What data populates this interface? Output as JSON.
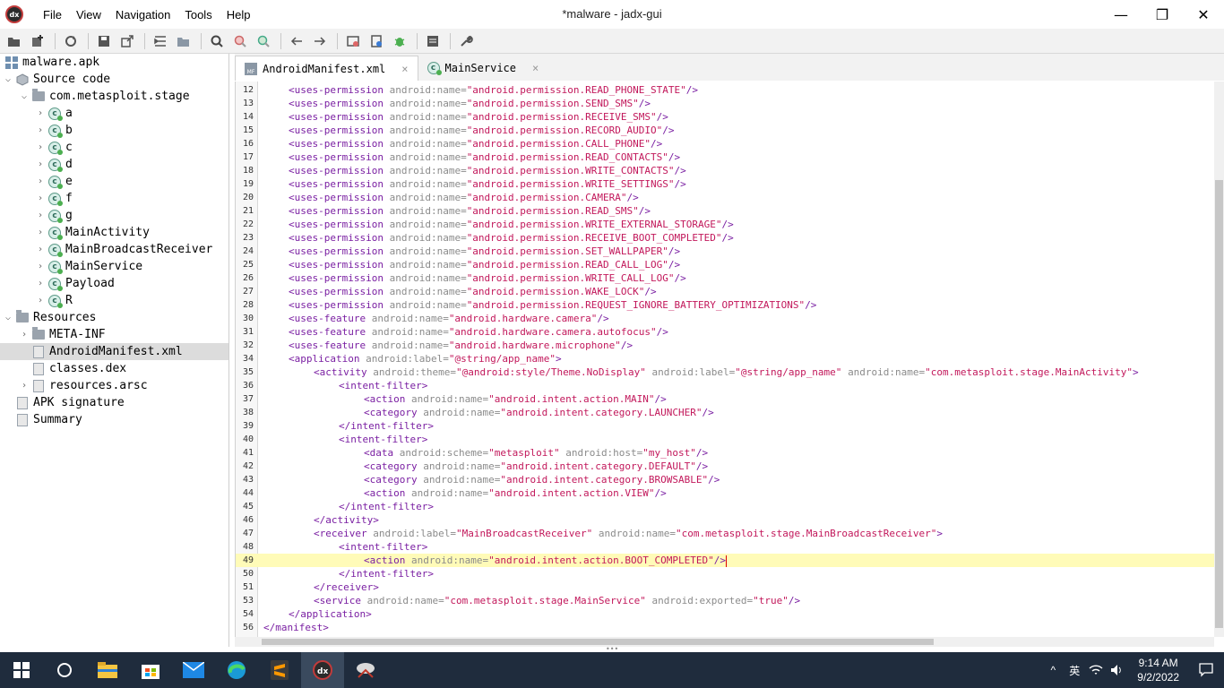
{
  "window": {
    "title": "*malware - jadx-gui",
    "app_icon_text": "dx",
    "minimize": "—",
    "maximize": "❐",
    "close": "✕"
  },
  "menu": [
    "File",
    "View",
    "Navigation",
    "Tools",
    "Help"
  ],
  "toolbar": {
    "icons": [
      "open-icon",
      "add-files-icon",
      "sync-icon",
      "save-icon",
      "export-icon",
      "flatten-icon",
      "packages-icon",
      "search-icon",
      "find-usage-icon",
      "goto-icon",
      "back-icon",
      "forward-icon",
      "decompile-icon",
      "bookmark-icon",
      "debug-icon",
      "log-icon",
      "settings-icon"
    ]
  },
  "tree": {
    "items": [
      {
        "label": "malware.apk",
        "level": 0,
        "arrow": "",
        "icon": "apk"
      },
      {
        "label": "Source code",
        "level": 0,
        "arrow": "v",
        "icon": "package"
      },
      {
        "label": "com.metasploit.stage",
        "level": 1,
        "arrow": "v",
        "icon": "folder"
      },
      {
        "label": "a",
        "level": 2,
        "arrow": ">",
        "icon": "class"
      },
      {
        "label": "b",
        "level": 2,
        "arrow": ">",
        "icon": "class"
      },
      {
        "label": "c",
        "level": 2,
        "arrow": ">",
        "icon": "class"
      },
      {
        "label": "d",
        "level": 2,
        "arrow": ">",
        "icon": "class"
      },
      {
        "label": "e",
        "level": 2,
        "arrow": ">",
        "icon": "class"
      },
      {
        "label": "f",
        "level": 2,
        "arrow": ">",
        "icon": "class"
      },
      {
        "label": "g",
        "level": 2,
        "arrow": ">",
        "icon": "class"
      },
      {
        "label": "MainActivity",
        "level": 2,
        "arrow": ">",
        "icon": "class"
      },
      {
        "label": "MainBroadcastReceiver",
        "level": 2,
        "arrow": ">",
        "icon": "class"
      },
      {
        "label": "MainService",
        "level": 2,
        "arrow": ">",
        "icon": "class"
      },
      {
        "label": "Payload",
        "level": 2,
        "arrow": ">",
        "icon": "class"
      },
      {
        "label": "R",
        "level": 2,
        "arrow": ">",
        "icon": "class"
      },
      {
        "label": "Resources",
        "level": 0,
        "arrow": "v",
        "icon": "folder"
      },
      {
        "label": "META-INF",
        "level": 1,
        "arrow": ">",
        "icon": "folder"
      },
      {
        "label": "AndroidManifest.xml",
        "level": 1,
        "arrow": "",
        "icon": "file",
        "selected": true
      },
      {
        "label": "classes.dex",
        "level": 1,
        "arrow": "",
        "icon": "file"
      },
      {
        "label": "resources.arsc",
        "level": 1,
        "arrow": ">",
        "icon": "file"
      },
      {
        "label": "APK signature",
        "level": 0,
        "arrow": "",
        "icon": "file"
      },
      {
        "label": "Summary",
        "level": 0,
        "arrow": "",
        "icon": "file"
      }
    ]
  },
  "tabs": [
    {
      "label": "AndroidManifest.xml",
      "icon_text": "MF",
      "active": true,
      "close": "×"
    },
    {
      "label": "MainService",
      "icon_text": "c",
      "active": false,
      "close": "×"
    }
  ],
  "editor": {
    "current_line": "49",
    "lines": [
      {
        "n": "12",
        "indent": 4,
        "tag": "<uses-permission",
        "attrs": [
          [
            "android:name=",
            "\"android.permission.READ_PHONE_STATE\""
          ]
        ],
        "end": "/>"
      },
      {
        "n": "13",
        "indent": 4,
        "tag": "<uses-permission",
        "attrs": [
          [
            "android:name=",
            "\"android.permission.SEND_SMS\""
          ]
        ],
        "end": "/>"
      },
      {
        "n": "14",
        "indent": 4,
        "tag": "<uses-permission",
        "attrs": [
          [
            "android:name=",
            "\"android.permission.RECEIVE_SMS\""
          ]
        ],
        "end": "/>"
      },
      {
        "n": "15",
        "indent": 4,
        "tag": "<uses-permission",
        "attrs": [
          [
            "android:name=",
            "\"android.permission.RECORD_AUDIO\""
          ]
        ],
        "end": "/>"
      },
      {
        "n": "16",
        "indent": 4,
        "tag": "<uses-permission",
        "attrs": [
          [
            "android:name=",
            "\"android.permission.CALL_PHONE\""
          ]
        ],
        "end": "/>"
      },
      {
        "n": "17",
        "indent": 4,
        "tag": "<uses-permission",
        "attrs": [
          [
            "android:name=",
            "\"android.permission.READ_CONTACTS\""
          ]
        ],
        "end": "/>"
      },
      {
        "n": "18",
        "indent": 4,
        "tag": "<uses-permission",
        "attrs": [
          [
            "android:name=",
            "\"android.permission.WRITE_CONTACTS\""
          ]
        ],
        "end": "/>"
      },
      {
        "n": "19",
        "indent": 4,
        "tag": "<uses-permission",
        "attrs": [
          [
            "android:name=",
            "\"android.permission.WRITE_SETTINGS\""
          ]
        ],
        "end": "/>"
      },
      {
        "n": "20",
        "indent": 4,
        "tag": "<uses-permission",
        "attrs": [
          [
            "android:name=",
            "\"android.permission.CAMERA\""
          ]
        ],
        "end": "/>"
      },
      {
        "n": "21",
        "indent": 4,
        "tag": "<uses-permission",
        "attrs": [
          [
            "android:name=",
            "\"android.permission.READ_SMS\""
          ]
        ],
        "end": "/>"
      },
      {
        "n": "22",
        "indent": 4,
        "tag": "<uses-permission",
        "attrs": [
          [
            "android:name=",
            "\"android.permission.WRITE_EXTERNAL_STORAGE\""
          ]
        ],
        "end": "/>"
      },
      {
        "n": "23",
        "indent": 4,
        "tag": "<uses-permission",
        "attrs": [
          [
            "android:name=",
            "\"android.permission.RECEIVE_BOOT_COMPLETED\""
          ]
        ],
        "end": "/>"
      },
      {
        "n": "24",
        "indent": 4,
        "tag": "<uses-permission",
        "attrs": [
          [
            "android:name=",
            "\"android.permission.SET_WALLPAPER\""
          ]
        ],
        "end": "/>"
      },
      {
        "n": "25",
        "indent": 4,
        "tag": "<uses-permission",
        "attrs": [
          [
            "android:name=",
            "\"android.permission.READ_CALL_LOG\""
          ]
        ],
        "end": "/>"
      },
      {
        "n": "26",
        "indent": 4,
        "tag": "<uses-permission",
        "attrs": [
          [
            "android:name=",
            "\"android.permission.WRITE_CALL_LOG\""
          ]
        ],
        "end": "/>"
      },
      {
        "n": "27",
        "indent": 4,
        "tag": "<uses-permission",
        "attrs": [
          [
            "android:name=",
            "\"android.permission.WAKE_LOCK\""
          ]
        ],
        "end": "/>"
      },
      {
        "n": "28",
        "indent": 4,
        "tag": "<uses-permission",
        "attrs": [
          [
            "android:name=",
            "\"android.permission.REQUEST_IGNORE_BATTERY_OPTIMIZATIONS\""
          ]
        ],
        "end": "/>"
      },
      {
        "n": "30",
        "indent": 4,
        "tag": "<uses-feature",
        "attrs": [
          [
            "android:name=",
            "\"android.hardware.camera\""
          ]
        ],
        "end": "/>"
      },
      {
        "n": "31",
        "indent": 4,
        "tag": "<uses-feature",
        "attrs": [
          [
            "android:name=",
            "\"android.hardware.camera.autofocus\""
          ]
        ],
        "end": "/>"
      },
      {
        "n": "32",
        "indent": 4,
        "tag": "<uses-feature",
        "attrs": [
          [
            "android:name=",
            "\"android.hardware.microphone\""
          ]
        ],
        "end": "/>"
      },
      {
        "n": "34",
        "indent": 4,
        "tag": "<application",
        "attrs": [
          [
            "android:label=",
            "\"@string/app_name\""
          ]
        ],
        "end": ">"
      },
      {
        "n": "35",
        "indent": 8,
        "tag": "<activity",
        "attrs": [
          [
            "android:theme=",
            "\"@android:style/Theme.NoDisplay\""
          ],
          [
            "android:label=",
            "\"@string/app_name\""
          ],
          [
            "android:name=",
            "\"com.metasploit.stage.MainActivity\""
          ]
        ],
        "end": ">"
      },
      {
        "n": "36",
        "indent": 12,
        "tag": "<intent-filter",
        "attrs": [],
        "end": ">"
      },
      {
        "n": "37",
        "indent": 16,
        "tag": "<action",
        "attrs": [
          [
            "android:name=",
            "\"android.intent.action.MAIN\""
          ]
        ],
        "end": "/>"
      },
      {
        "n": "38",
        "indent": 16,
        "tag": "<category",
        "attrs": [
          [
            "android:name=",
            "\"android.intent.category.LAUNCHER\""
          ]
        ],
        "end": "/>"
      },
      {
        "n": "39",
        "indent": 12,
        "tag": "</intent-filter",
        "attrs": [],
        "end": ">"
      },
      {
        "n": "40",
        "indent": 12,
        "tag": "<intent-filter",
        "attrs": [],
        "end": ">"
      },
      {
        "n": "41",
        "indent": 16,
        "tag": "<data",
        "attrs": [
          [
            "android:scheme=",
            "\"metasploit\""
          ],
          [
            "android:host=",
            "\"my_host\""
          ]
        ],
        "end": "/>"
      },
      {
        "n": "42",
        "indent": 16,
        "tag": "<category",
        "attrs": [
          [
            "android:name=",
            "\"android.intent.category.DEFAULT\""
          ]
        ],
        "end": "/>"
      },
      {
        "n": "43",
        "indent": 16,
        "tag": "<category",
        "attrs": [
          [
            "android:name=",
            "\"android.intent.category.BROWSABLE\""
          ]
        ],
        "end": "/>"
      },
      {
        "n": "44",
        "indent": 16,
        "tag": "<action",
        "attrs": [
          [
            "android:name=",
            "\"android.intent.action.VIEW\""
          ]
        ],
        "end": "/>"
      },
      {
        "n": "45",
        "indent": 12,
        "tag": "</intent-filter",
        "attrs": [],
        "end": ">"
      },
      {
        "n": "46",
        "indent": 8,
        "tag": "</activity",
        "attrs": [],
        "end": ">"
      },
      {
        "n": "47",
        "indent": 8,
        "tag": "<receiver",
        "attrs": [
          [
            "android:label=",
            "\"MainBroadcastReceiver\""
          ],
          [
            "android:name=",
            "\"com.metasploit.stage.MainBroadcastReceiver\""
          ]
        ],
        "end": ">"
      },
      {
        "n": "48",
        "indent": 12,
        "tag": "<intent-filter",
        "attrs": [],
        "end": ">"
      },
      {
        "n": "49",
        "indent": 16,
        "tag": "<action",
        "attrs": [
          [
            "android:name=",
            "\"android.intent.action.BOOT_COMPLETED\""
          ]
        ],
        "end": "/>"
      },
      {
        "n": "50",
        "indent": 12,
        "tag": "</intent-filter",
        "attrs": [],
        "end": ">"
      },
      {
        "n": "51",
        "indent": 8,
        "tag": "</receiver",
        "attrs": [],
        "end": ">"
      },
      {
        "n": "53",
        "indent": 8,
        "tag": "<service",
        "attrs": [
          [
            "android:name=",
            "\"com.metasploit.stage.MainService\""
          ],
          [
            "android:exported=",
            "\"true\""
          ]
        ],
        "end": "/>"
      },
      {
        "n": "54",
        "indent": 4,
        "tag": "</application",
        "attrs": [],
        "end": ">"
      },
      {
        "n": "56",
        "indent": 0,
        "tag": "</manifest",
        "attrs": [],
        "end": ">"
      }
    ]
  },
  "taskbar": {
    "apps": [
      "start-icon",
      "search-icon",
      "file-explorer-icon",
      "store-icon",
      "mail-icon",
      "edge-icon",
      "sublime-icon",
      "jadx-icon",
      "network-tool-icon"
    ],
    "active": "jadx-icon",
    "tray_lang": "英",
    "time": "9:14 AM",
    "date": "9/2/2022"
  },
  "colors": {
    "tag": "#7a1fa2",
    "attribute": "#8b8b8b",
    "value": "#c2185b",
    "current_line": "#fffbb8",
    "taskbar": "#1f2c3d"
  }
}
